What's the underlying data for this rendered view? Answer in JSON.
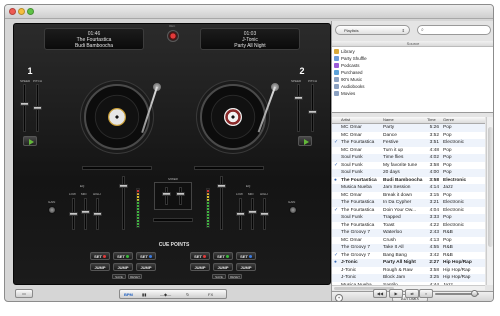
{
  "window": {
    "controls": [
      "close",
      "minimize",
      "zoom"
    ]
  },
  "decks": {
    "left": {
      "time": "01:46",
      "artist": "The Fourtastica",
      "title": "Budi Bamboocha",
      "number": "1",
      "speed_label": "SPEED",
      "pitch_label": "PITCH"
    },
    "right": {
      "time": "01:03",
      "artist": "J-Tonic",
      "title": "Party All Night",
      "number": "2",
      "speed_label": "SPEED",
      "pitch_label": "PITCH"
    },
    "rec_label": "REC"
  },
  "mixer": {
    "title": "MIXER",
    "eq_labels": [
      "LOW",
      "MID",
      "HIGH"
    ],
    "eq_title": "EQ",
    "gain_label": "GAIN"
  },
  "cue_points": {
    "title": "CUE POINTS",
    "set_label": "SET",
    "jump_label": "JUMP",
    "save_label": "SAVE",
    "reset_label": "RESET",
    "dot_colors": [
      "#e03a3a",
      "#3cbc3c",
      "#3a7ae0"
    ]
  },
  "bottombar": {
    "bpm_label": "BPM",
    "fx_label": "FX"
  },
  "browser": {
    "playlist_select": "Playlists",
    "search_placeholder": "",
    "source_header": "Source",
    "sources": [
      {
        "label": "Library",
        "icon": "library-icon",
        "color": "#d8a93a"
      },
      {
        "label": "Party Shuffle",
        "icon": "shuffle-icon",
        "color": "#6a9ad8"
      },
      {
        "label": "Podcasts",
        "icon": "podcast-icon",
        "color": "#9a5ad8"
      },
      {
        "label": "Purchased",
        "icon": "purchased-icon",
        "color": "#5aa0d8"
      },
      {
        "label": "90's Music",
        "icon": "smart-playlist-icon",
        "color": "#8aa0c0"
      },
      {
        "label": "Audiobooks",
        "icon": "audiobook-icon",
        "color": "#8aa0c0"
      },
      {
        "label": "Movies",
        "icon": "movie-icon",
        "color": "#8aa0c0"
      }
    ],
    "columns": {
      "artist": "Artist",
      "name": "Name",
      "time": "Time",
      "genre": "Genre"
    },
    "tracks": [
      {
        "check": "",
        "artist": "MC Omar",
        "name": "Party",
        "time": "5:26",
        "genre": "Pop",
        "bold": false
      },
      {
        "check": "",
        "artist": "MC Omar",
        "name": "Dance",
        "time": "3:52",
        "genre": "Pop",
        "bold": false
      },
      {
        "check": "✓",
        "artist": "The Fourtastica",
        "name": "Festive",
        "time": "3:51",
        "genre": "Electronic",
        "bold": false
      },
      {
        "check": "",
        "artist": "MC Omar",
        "name": "Turn it up",
        "time": "4:48",
        "genre": "Pop",
        "bold": false
      },
      {
        "check": "",
        "artist": "Soul Funk",
        "name": "Time flies",
        "time": "4:02",
        "genre": "Pop",
        "bold": false
      },
      {
        "check": "✓",
        "artist": "Soul Funk",
        "name": "My favorite tune",
        "time": "3:58",
        "genre": "Pop",
        "bold": false
      },
      {
        "check": "",
        "artist": "Soul Funk",
        "name": "20 days",
        "time": "4:00",
        "genre": "Pop",
        "bold": false
      },
      {
        "check": "●",
        "artist": "The Fourtastica",
        "name": "Budi Bamboocha",
        "time": "3:58",
        "genre": "Electronic",
        "bold": true
      },
      {
        "check": "",
        "artist": "Musica Nueba",
        "name": "Jam Session",
        "time": "4:14",
        "genre": "Jazz",
        "bold": false
      },
      {
        "check": "",
        "artist": "MC Omar",
        "name": "Break it down",
        "time": "3:15",
        "genre": "Pop",
        "bold": false
      },
      {
        "check": "",
        "artist": "The Fourtastica",
        "name": "In Da Cypher",
        "time": "3:21",
        "genre": "Electronic",
        "bold": false
      },
      {
        "check": "✓",
        "artist": "The Fourtastica",
        "name": "Doin Your Ow...",
        "time": "4:04",
        "genre": "Electronic",
        "bold": false
      },
      {
        "check": "",
        "artist": "Soul Funk",
        "name": "Trapped",
        "time": "3:33",
        "genre": "Pop",
        "bold": false
      },
      {
        "check": "",
        "artist": "The Fourtastica",
        "name": "Toast",
        "time": "4:22",
        "genre": "Electronic",
        "bold": false
      },
      {
        "check": "",
        "artist": "The Groovy 7",
        "name": "Waterloo",
        "time": "2:43",
        "genre": "R&B",
        "bold": false
      },
      {
        "check": "",
        "artist": "MC Omar",
        "name": "Crush",
        "time": "4:13",
        "genre": "Pop",
        "bold": false
      },
      {
        "check": "",
        "artist": "The Groovy 7",
        "name": "Take It All",
        "time": "4:55",
        "genre": "R&B",
        "bold": false
      },
      {
        "check": "✓",
        "artist": "The Groovy 7",
        "name": "Bang Bang",
        "time": "3:42",
        "genre": "R&B",
        "bold": false
      },
      {
        "check": "●",
        "artist": "J-Tonic",
        "name": "Party All Night",
        "time": "2:27",
        "genre": "Hip Hop/Rap",
        "bold": true
      },
      {
        "check": "",
        "artist": "J-Tonic",
        "name": "Rough & Raw",
        "time": "3:58",
        "genre": "Hip Hop/Rap",
        "bold": false
      },
      {
        "check": "",
        "artist": "J-Tonic",
        "name": "Block Jam",
        "time": "3:25",
        "genre": "Hip Hop/Rap",
        "bold": false
      },
      {
        "check": "",
        "artist": "Musica Nueba",
        "name": "Santilo",
        "time": "4:44",
        "genre": "Jazz",
        "bold": false
      }
    ],
    "automix_label": "AUTOMIX"
  }
}
